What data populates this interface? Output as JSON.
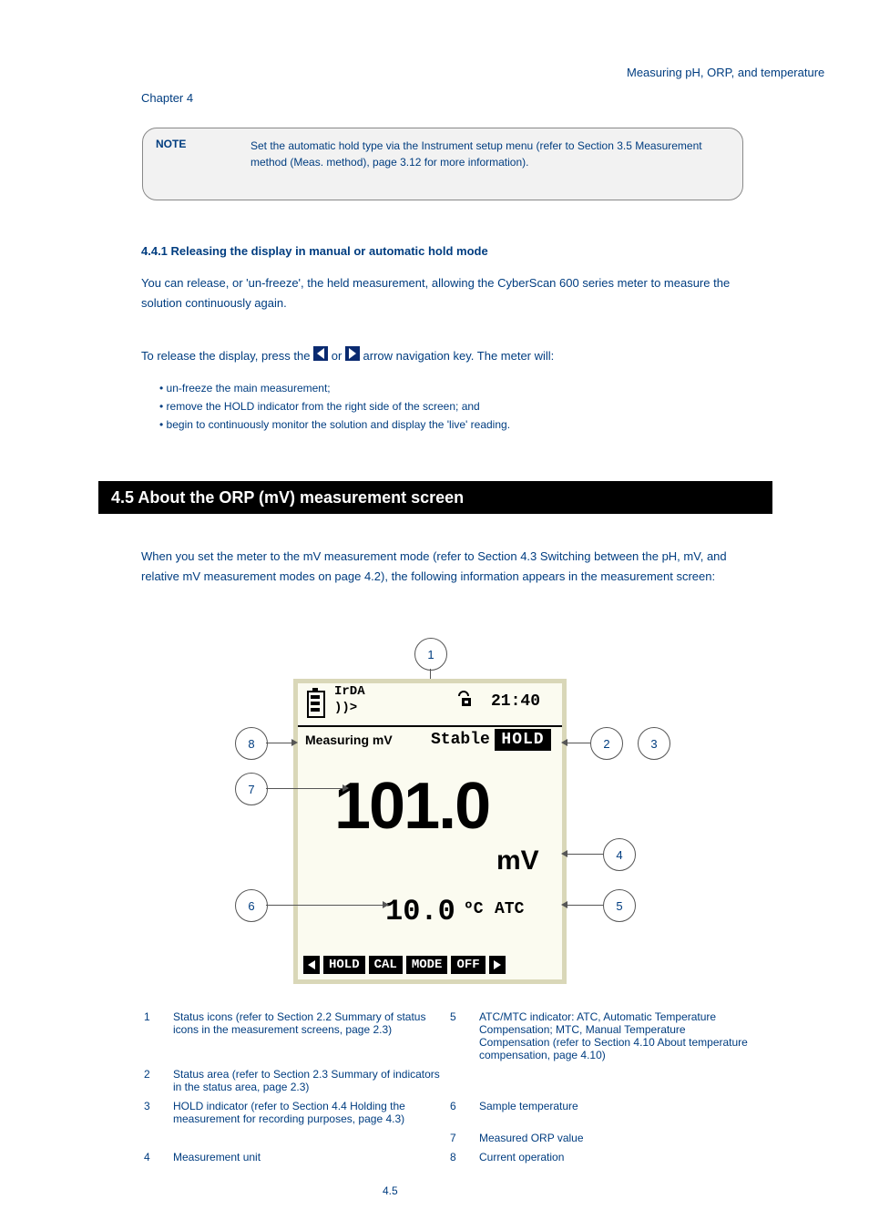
{
  "header": {
    "right": "Measuring pH, ORP, and temperature",
    "chapter": "Chapter 4"
  },
  "note": {
    "label": "NOTE",
    "body": "Set the automatic hold type via the Instrument setup menu (refer to Section 3.5 Measurement method (Meas. method), page 3.12 for more information)."
  },
  "sec1": {
    "title": "4.4.1 Releasing the display in manual or automatic hold mode",
    "para": "You can release, or 'un-freeze', the held measurement, allowing the CyberScan 600 series meter to measure the solution continuously again."
  },
  "instr": {
    "prefix": "To release the display, press the ",
    "mid": " or ",
    "suffix": " arrow navigation key. The meter will:"
  },
  "bullets": [
    "un-freeze the main measurement;",
    "remove the HOLD indicator from the right side of the screen; and",
    "begin to continuously monitor the solution and display the 'live' reading."
  ],
  "section_bar": "4.5 About the ORP (mV) measurement screen",
  "para2": "When you set the meter to the mV measurement mode (refer to Section 4.3 Switching between the pH, mV, and relative mV measurement modes on page 4.2), the following information appears in the measurement screen:",
  "lcd": {
    "irda": "IrDA",
    "irda_signal": "))>",
    "time": "21:40",
    "measuring": "Measuring mV",
    "stable": "Stable",
    "hold": "HOLD",
    "big_value": "101.0",
    "unit": "mV",
    "temp_value": "10.0",
    "temp_unit": "ºC",
    "atc": "ATC",
    "menu": {
      "left_tri": "◀",
      "hold": "HOLD",
      "cal": "CAL",
      "mode": "MODE",
      "off": "OFF",
      "right_tri": "▶"
    }
  },
  "callouts": {
    "c1": "1",
    "c2": "2",
    "c3": "3",
    "c4": "4",
    "c5": "5",
    "c6": "6",
    "c7": "7",
    "c8": "8"
  },
  "legend": {
    "r1": "Status icons (refer to Section 2.2 Summary of status icons in the measurement screens, page 2.3)",
    "r2": "Status area (refer to Section 2.3 Summary of indicators in the status area, page 2.3)",
    "r3": "HOLD indicator (refer to Section 4.4 Holding the measurement for recording purposes, page 4.3)",
    "r4": "Measurement unit",
    "r5": "ATC/MTC indicator: ATC, Automatic Temperature Compensation; MTC, Manual Temperature Compensation (refer to Section 4.10 About temperature compensation, page 4.10)",
    "r6": "Sample temperature",
    "r7": "Measured ORP value",
    "r8": "Current operation"
  },
  "footer": "4.5"
}
